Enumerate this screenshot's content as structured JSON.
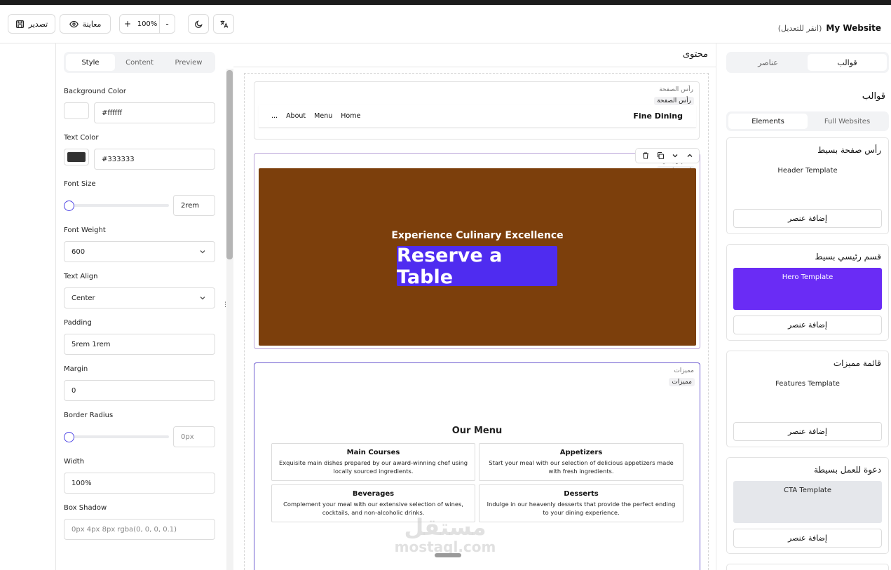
{
  "header": {
    "site_name": "My Website",
    "edit_hint": "(انقر للتعديل)",
    "export_label": "تصدير",
    "preview_label": "معاينة",
    "zoom_plus": "+",
    "zoom_minus": "-",
    "zoom_value": "100%"
  },
  "left_panel": {
    "tabs": [
      "Style",
      "Content",
      "Preview"
    ],
    "active_tab": "Style",
    "background_color": {
      "label": "Background Color",
      "value": "#ffffff",
      "swatch": "#ffffff"
    },
    "text_color": {
      "label": "Text Color",
      "value": "#333333",
      "swatch": "#333333"
    },
    "font_size": {
      "label": "Font Size",
      "value": "2rem"
    },
    "font_weight": {
      "label": "Font Weight",
      "value": "600"
    },
    "text_align": {
      "label": "Text Align",
      "value": "Center"
    },
    "padding": {
      "label": "Padding",
      "value": "5rem 1rem"
    },
    "margin": {
      "label": "Margin",
      "value": "0"
    },
    "border_radius": {
      "label": "Border Radius",
      "placeholder": "0px"
    },
    "width": {
      "label": "Width",
      "value": "100%"
    },
    "box_shadow": {
      "label": "Box Shadow",
      "placeholder": "0px 4px 8px rgba(0, 0, 0, 0.1)"
    }
  },
  "center": {
    "title": "محتوى",
    "header_block": {
      "label": "رأس الصفحة",
      "tag": "رأس الصفحة",
      "brand": "Fine Dining",
      "links": [
        "Home",
        "Menu",
        "About",
        "..."
      ]
    },
    "hero_block": {
      "label": "قسم رئيسي",
      "tag": "قسم رئيسي",
      "title": "Experience Culinary Excellence",
      "button": "Reserve a Table",
      "bg_color": "#7c3f0c",
      "button_color": "#4f2cf0"
    },
    "features_block": {
      "label": "مميزات",
      "tag": "مميزات",
      "title": "Our Menu",
      "items": [
        {
          "title": "Main Courses",
          "desc": "Exquisite main dishes prepared by our award-winning chef using locally sourced ingredients."
        },
        {
          "title": "Appetizers",
          "desc": "Start your meal with our selection of delicious appetizers made with fresh ingredients."
        },
        {
          "title": "Beverages",
          "desc": "Complement your meal with our extensive selection of wines, cocktails, and non-alcoholic drinks."
        },
        {
          "title": "Desserts",
          "desc": "Indulge in our heavenly desserts that provide the perfect ending to your dining experience."
        }
      ]
    }
  },
  "right_panel": {
    "tabs": [
      "قوالب",
      "عناصر"
    ],
    "active_tab": "قوالب",
    "section_title": "قوالب",
    "subtabs": [
      "Elements",
      "Full Websites"
    ],
    "active_subtab": "Elements",
    "templates": [
      {
        "title": "رأس صفحة بسيط",
        "preview": "Header Template",
        "add": "إضافة عنصر"
      },
      {
        "title": "قسم رئيسي بسيط",
        "preview": "Hero Template",
        "add": "إضافة عنصر",
        "preview_color": "#6a2cf5"
      },
      {
        "title": "قائمة مميزات",
        "preview": "Features Template",
        "add": "إضافة عنصر"
      },
      {
        "title": "دعوة للعمل بسيطة",
        "preview": "CTA Template",
        "add": "إضافة عنصر",
        "preview_color": "#e5e7eb"
      }
    ]
  },
  "watermark": {
    "line1": "مستقل",
    "line2": "mostaql.com"
  }
}
